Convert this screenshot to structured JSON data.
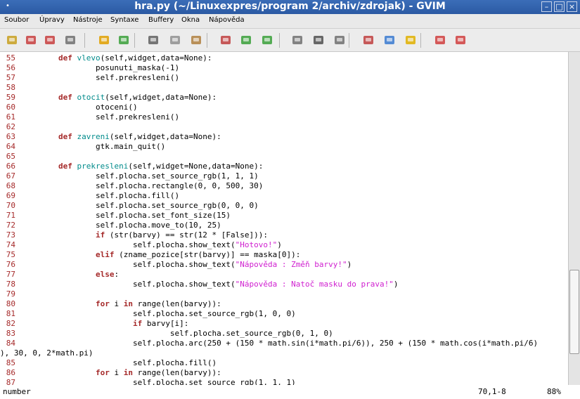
{
  "window": {
    "title": "hra.py (~/Linuxexpres/program 2/archiv/zdrojak) - GVIM"
  },
  "menu": [
    {
      "label": "Soubor"
    },
    {
      "label": "Úpravy"
    },
    {
      "label": "Nástroje"
    },
    {
      "label": "Syntaxe"
    },
    {
      "label": "Buffery"
    },
    {
      "label": "Okna"
    },
    {
      "label": "Nápověda"
    }
  ],
  "toolbar": [
    {
      "name": "open-icon",
      "color": "#c8a020"
    },
    {
      "name": "save-icon",
      "color": "#c84040"
    },
    {
      "name": "save-all-icon",
      "color": "#c84040"
    },
    {
      "name": "print-icon",
      "color": "#707070"
    },
    {
      "name": "undo-icon",
      "color": "#e0a000"
    },
    {
      "name": "redo-icon",
      "color": "#3aa03a"
    },
    {
      "name": "cut-icon",
      "color": "#606060"
    },
    {
      "name": "copy-icon",
      "color": "#909090"
    },
    {
      "name": "paste-icon",
      "color": "#b08040"
    },
    {
      "name": "replace-icon",
      "color": "#c04040"
    },
    {
      "name": "find-next-icon",
      "color": "#3aa03a"
    },
    {
      "name": "find-prev-icon",
      "color": "#3aa03a"
    },
    {
      "name": "load-session-icon",
      "color": "#707070"
    },
    {
      "name": "save-session-icon",
      "color": "#505050"
    },
    {
      "name": "run-script-icon",
      "color": "#707070"
    },
    {
      "name": "make-icon",
      "color": "#c04040"
    },
    {
      "name": "build-tags-icon",
      "color": "#3a7ad0"
    },
    {
      "name": "jump-tag-icon",
      "color": "#e0b000"
    },
    {
      "name": "help-icon",
      "color": "#d04040"
    },
    {
      "name": "find-help-icon",
      "color": "#d04040"
    }
  ],
  "code": [
    {
      "n": "55",
      "tokens": [
        [
          "t",
          "        "
        ],
        [
          "kw",
          "def"
        ],
        [
          "t",
          " "
        ],
        [
          "fn",
          "vlevo"
        ],
        [
          "t",
          "(self,widget,data=None):"
        ]
      ]
    },
    {
      "n": "56",
      "tokens": [
        [
          "t",
          "                posunuti_maska(-1)"
        ]
      ]
    },
    {
      "n": "57",
      "tokens": [
        [
          "t",
          "                self.prekresleni()"
        ]
      ]
    },
    {
      "n": "58",
      "tokens": []
    },
    {
      "n": "59",
      "tokens": [
        [
          "t",
          "        "
        ],
        [
          "kw",
          "def"
        ],
        [
          "t",
          " "
        ],
        [
          "fn",
          "otocit"
        ],
        [
          "t",
          "(self,widget,data=None):"
        ]
      ]
    },
    {
      "n": "60",
      "tokens": [
        [
          "t",
          "                otoceni()"
        ]
      ]
    },
    {
      "n": "61",
      "tokens": [
        [
          "t",
          "                self.prekresleni()"
        ]
      ]
    },
    {
      "n": "62",
      "tokens": []
    },
    {
      "n": "63",
      "tokens": [
        [
          "t",
          "        "
        ],
        [
          "kw",
          "def"
        ],
        [
          "t",
          " "
        ],
        [
          "fn",
          "zavreni"
        ],
        [
          "t",
          "(self,widget,data=None):"
        ]
      ]
    },
    {
      "n": "64",
      "tokens": [
        [
          "t",
          "                gtk.main_quit()"
        ]
      ]
    },
    {
      "n": "65",
      "tokens": []
    },
    {
      "n": "66",
      "tokens": [
        [
          "t",
          "        "
        ],
        [
          "kw",
          "def"
        ],
        [
          "t",
          " "
        ],
        [
          "fn",
          "prekresleni"
        ],
        [
          "t",
          "(self,widget=None,data=None):"
        ]
      ]
    },
    {
      "n": "67",
      "tokens": [
        [
          "t",
          "                self.plocha.set_source_rgb(1, 1, 1)"
        ]
      ]
    },
    {
      "n": "68",
      "tokens": [
        [
          "t",
          "                self.plocha.rectangle(0, 0, 500, 30)"
        ]
      ]
    },
    {
      "n": "69",
      "tokens": [
        [
          "t",
          "                self.plocha.fill()"
        ]
      ]
    },
    {
      "n": "70",
      "tokens": [
        [
          "t",
          "                self.plocha.set_source_rgb(0, 0, 0)"
        ]
      ]
    },
    {
      "n": "71",
      "tokens": [
        [
          "t",
          "                self.plocha.set_font_size(15)"
        ]
      ]
    },
    {
      "n": "72",
      "tokens": [
        [
          "t",
          "                self.plocha.move_to(10, 25)"
        ]
      ]
    },
    {
      "n": "73",
      "tokens": [
        [
          "t",
          "                "
        ],
        [
          "kw",
          "if"
        ],
        [
          "t",
          " (str(barvy) == str(12 * [False])):"
        ]
      ]
    },
    {
      "n": "74",
      "tokens": [
        [
          "t",
          "                        self.plocha.show_text("
        ],
        [
          "st",
          "\"Hotovo!\""
        ],
        [
          "t",
          ")"
        ]
      ]
    },
    {
      "n": "75",
      "tokens": [
        [
          "t",
          "                "
        ],
        [
          "kw",
          "elif"
        ],
        [
          "t",
          " (zname_pozice[str(barvy)] == maska[0]):"
        ]
      ]
    },
    {
      "n": "76",
      "tokens": [
        [
          "t",
          "                        self.plocha.show_text("
        ],
        [
          "st",
          "\"Nápověda : Změň barvy!\""
        ],
        [
          "t",
          ")"
        ]
      ]
    },
    {
      "n": "77",
      "tokens": [
        [
          "t",
          "                "
        ],
        [
          "kw",
          "else"
        ],
        [
          "t",
          ":"
        ]
      ]
    },
    {
      "n": "78",
      "tokens": [
        [
          "t",
          "                        self.plocha.show_text("
        ],
        [
          "st",
          "\"Nápověda : Natoč masku do prava!\""
        ],
        [
          "t",
          ")"
        ]
      ]
    },
    {
      "n": "79",
      "tokens": []
    },
    {
      "n": "80",
      "tokens": [
        [
          "t",
          "                "
        ],
        [
          "kw",
          "for"
        ],
        [
          "t",
          " i "
        ],
        [
          "kw",
          "in"
        ],
        [
          "t",
          " range(len(barvy)):"
        ]
      ]
    },
    {
      "n": "81",
      "tokens": [
        [
          "t",
          "                        self.plocha.set_source_rgb(1, 0, 0)"
        ]
      ]
    },
    {
      "n": "82",
      "tokens": [
        [
          "t",
          "                        "
        ],
        [
          "kw",
          "if"
        ],
        [
          "t",
          " barvy[i]:"
        ]
      ]
    },
    {
      "n": "83",
      "tokens": [
        [
          "t",
          "                                self.plocha.set_source_rgb(0, 1, 0)"
        ]
      ]
    },
    {
      "n": "84",
      "tokens": [
        [
          "t",
          "                        self.plocha.arc(250 + (150 * math.sin(i*math.pi/6)), 250 + (150 * math.cos(i*math.pi/6)"
        ]
      ]
    },
    {
      "n": "",
      "wrap": true,
      "tokens": [
        [
          "t",
          "), 30, 0, 2*math.pi)"
        ]
      ]
    },
    {
      "n": "85",
      "tokens": [
        [
          "t",
          "                        self.plocha.fill()"
        ]
      ]
    },
    {
      "n": "86",
      "tokens": [
        [
          "t",
          "                "
        ],
        [
          "kw",
          "for"
        ],
        [
          "t",
          " i "
        ],
        [
          "kw",
          "in"
        ],
        [
          "t",
          " range(len(barvy)):"
        ]
      ]
    },
    {
      "n": "87",
      "tokens": [
        [
          "t",
          "                        self.plocha.set_source_rgb(1, 1, 1)"
        ]
      ]
    }
  ],
  "scrollbar": {
    "position_percent": 88
  },
  "statusbar": {
    "message": "number",
    "cursor": "70,1-8",
    "percent": "88%"
  },
  "colors": {
    "keyword": "#a52a2a",
    "function": "#008b8b",
    "string": "#d020d0",
    "line_number": "#a52a2a"
  }
}
